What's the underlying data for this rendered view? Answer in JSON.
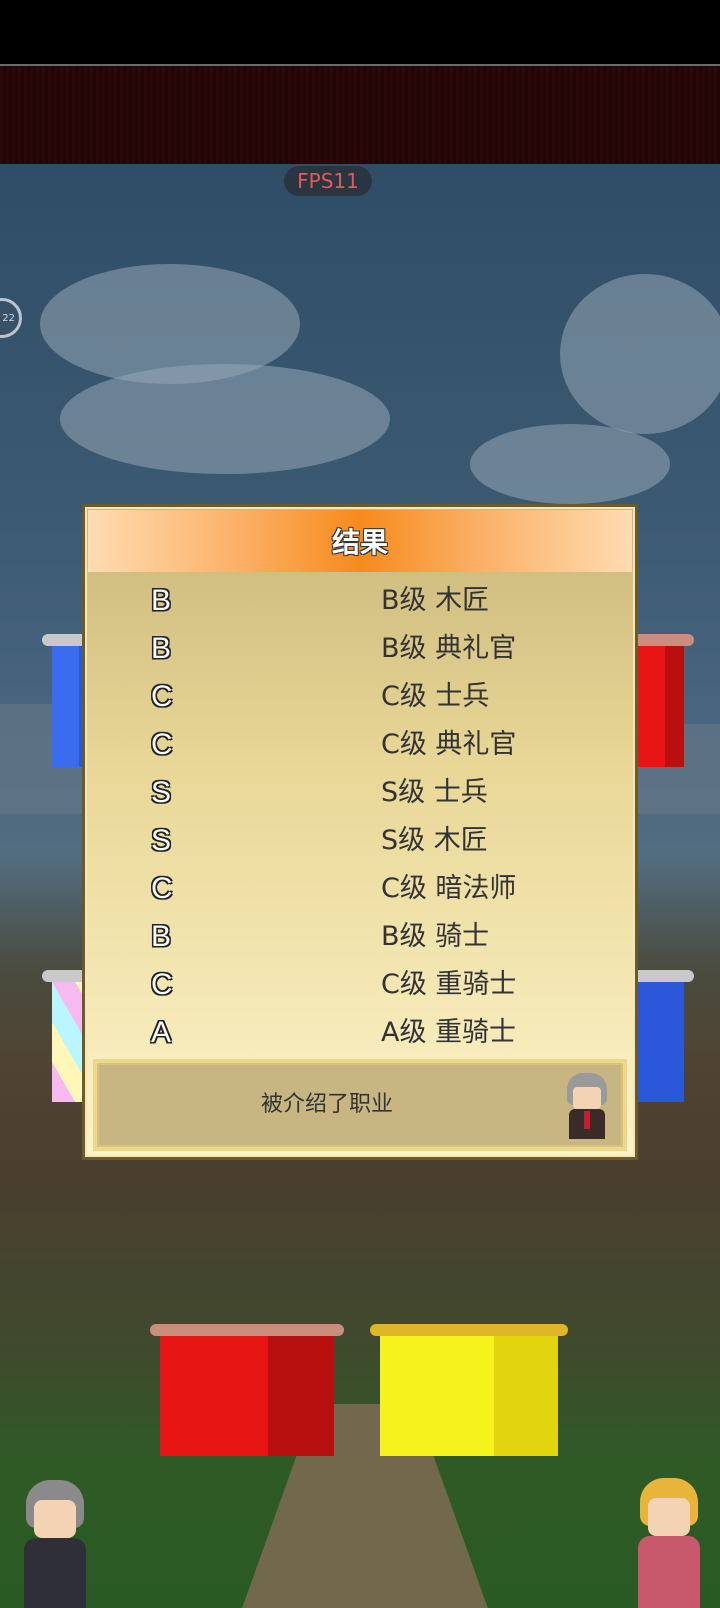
{
  "hud": {
    "fps_label": "FPS11",
    "side_button_label": "22"
  },
  "dialog": {
    "title": "结果",
    "results": [
      {
        "grade": "B",
        "job": "B级 木匠"
      },
      {
        "grade": "B",
        "job": "B级 典礼官"
      },
      {
        "grade": "C",
        "job": "C级 士兵"
      },
      {
        "grade": "C",
        "job": "C级 典礼官"
      },
      {
        "grade": "S",
        "job": "S级 士兵"
      },
      {
        "grade": "S",
        "job": "S级 木匠"
      },
      {
        "grade": "C",
        "job": "C级 暗法师"
      },
      {
        "grade": "B",
        "job": "B级 骑士"
      },
      {
        "grade": "C",
        "job": "C级 重骑士"
      },
      {
        "grade": "A",
        "job": "A级 重骑士"
      }
    ],
    "message": "被介绍了职业"
  },
  "colors": {
    "header_orange": "#f78a1c",
    "fps_red": "#e05a57",
    "curtain_red": "#e81515",
    "curtain_blue": "#3a6cf0",
    "curtain_yellow": "#f6f21c"
  }
}
